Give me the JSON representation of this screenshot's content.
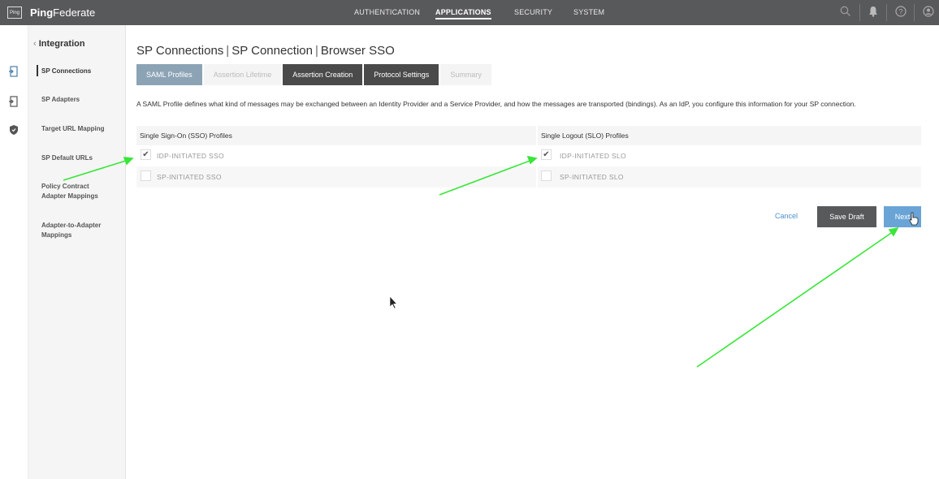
{
  "app": {
    "brand_bold": "Ping",
    "brand_rest": "Federate",
    "logo_text": "Ping"
  },
  "topnav": {
    "items": [
      {
        "label": "AUTHENTICATION",
        "active": false
      },
      {
        "label": "APPLICATIONS",
        "active": true
      },
      {
        "label": "SECURITY",
        "active": false
      },
      {
        "label": "SYSTEM",
        "active": false
      }
    ],
    "icons": [
      "search-icon",
      "bell-icon",
      "help-icon",
      "user-icon"
    ]
  },
  "sidebar": {
    "back_label": "Integration",
    "items": [
      {
        "label": "SP Connections",
        "active": true
      },
      {
        "label": "SP Adapters",
        "active": false
      },
      {
        "label": "Target URL Mapping",
        "active": false
      },
      {
        "label": "SP Default URLs",
        "active": false
      },
      {
        "label": "Policy Contract Adapter Mappings",
        "active": false
      },
      {
        "label": "Adapter-to-Adapter Mappings",
        "active": false
      }
    ]
  },
  "breadcrumb": {
    "part1": "SP Connections",
    "part2": "SP Connection",
    "part3": "Browser SSO"
  },
  "tabs": [
    {
      "label": "SAML Profiles",
      "state": "selected"
    },
    {
      "label": "Assertion Lifetime",
      "state": "disabled"
    },
    {
      "label": "Assertion Creation",
      "state": "dark"
    },
    {
      "label": "Protocol Settings",
      "state": "dark"
    },
    {
      "label": "Summary",
      "state": "disabled"
    }
  ],
  "description": "A SAML Profile defines what kind of messages may be exchanged between an Identity Provider and a Service Provider, and how the messages are transported (bindings). As an IdP, you configure this information for your SP connection.",
  "sso": {
    "header": "Single Sign-On (SSO) Profiles",
    "options": [
      {
        "label": "IDP-INITIATED SSO",
        "checked": true
      },
      {
        "label": "SP-INITIATED SSO",
        "checked": false
      }
    ]
  },
  "slo": {
    "header": "Single Logout (SLO) Profiles",
    "options": [
      {
        "label": "IDP-INITIATED SLO",
        "checked": true
      },
      {
        "label": "SP-INITIATED SLO",
        "checked": false
      }
    ]
  },
  "actions": {
    "cancel": "Cancel",
    "save_draft": "Save Draft",
    "next": "Next"
  },
  "colors": {
    "topbar": "#58595b",
    "tab_selected": "#8ca3b5",
    "tab_dark": "#4a4a4a",
    "next": "#6aa4d6",
    "annotation": "#39e639"
  }
}
